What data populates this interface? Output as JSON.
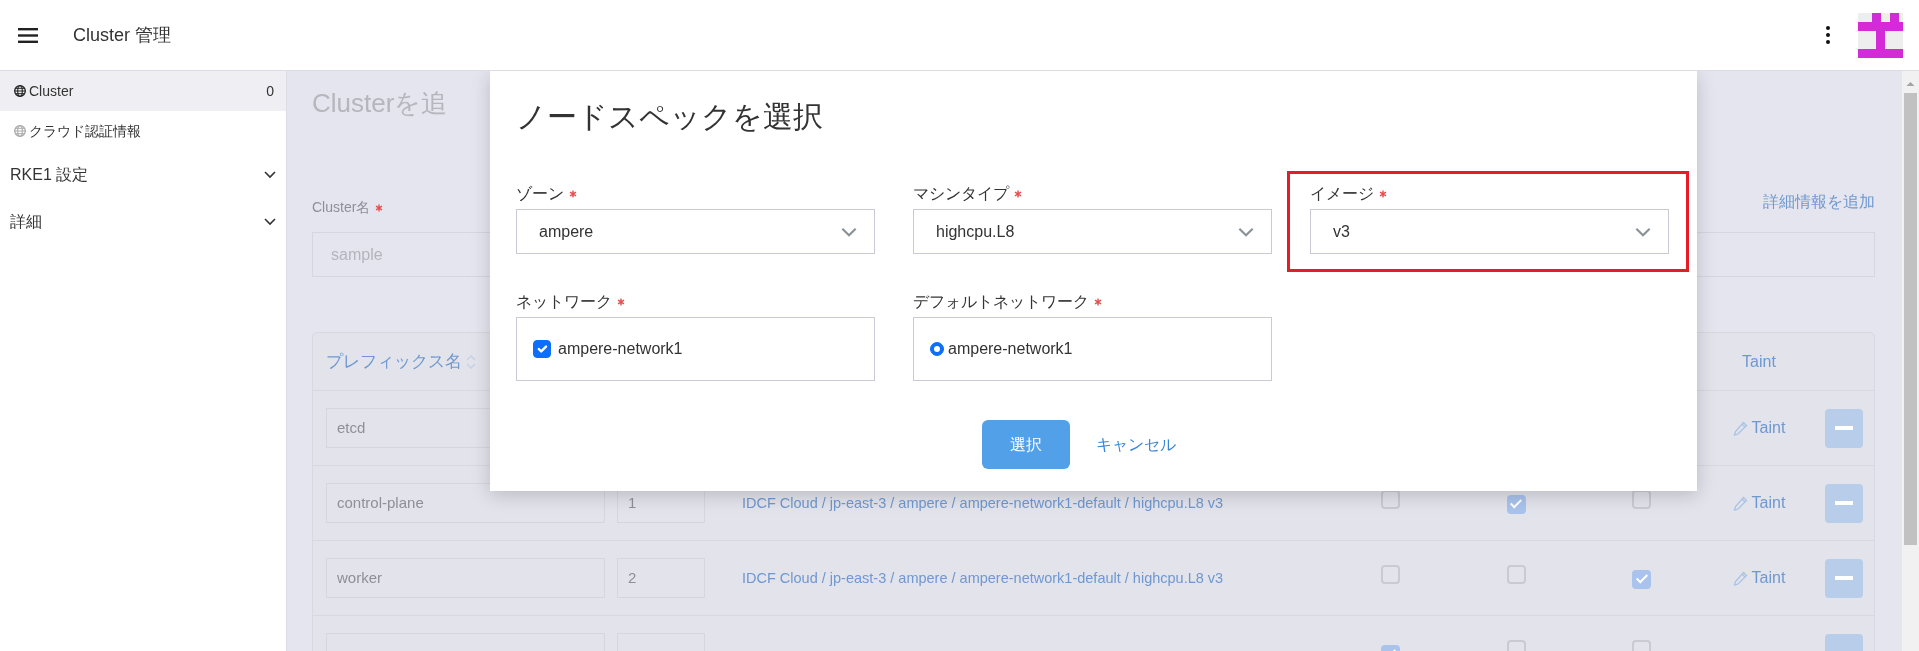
{
  "header": {
    "title": "Cluster 管理"
  },
  "sidebar": {
    "links": [
      {
        "label": "Cluster",
        "count": "0",
        "selected": true
      },
      {
        "label": "クラウド認証情報",
        "selected": false
      }
    ],
    "groups": [
      {
        "label": "RKE1 設定",
        "expanded": false
      },
      {
        "label": "詳細",
        "expanded": false
      }
    ]
  },
  "page": {
    "title": "Clusterを追",
    "name_label": "Cluster名",
    "name_required": true,
    "name_value": "sample",
    "detail_link": "詳細情報を追加"
  },
  "table": {
    "prefix_header": "プレフィックス名",
    "taint_header": "Taint",
    "rows": [
      {
        "prefix": "etcd",
        "taint": "Taint"
      },
      {
        "prefix": "control-plane",
        "count": "1",
        "spec": "IDCF Cloud / jp-east-3 / ampere / ampere-network1-default / highcpu.L8 v3",
        "flags": [
          {
            "checked": false
          },
          {
            "checked": true
          },
          {
            "checked": false
          }
        ],
        "taint": "Taint"
      },
      {
        "prefix": "worker",
        "count": "2",
        "spec": "IDCF Cloud / jp-east-3 / ampere / ampere-network1-default / highcpu.L8 v3",
        "flags": [
          {
            "checked": false
          },
          {
            "checked": false
          },
          {
            "checked": true
          }
        ],
        "taint": "Taint"
      },
      {
        "flags": [
          {
            "checked": true
          },
          {
            "checked": false
          },
          {
            "checked": false
          }
        ]
      }
    ]
  },
  "modal": {
    "title": "ノードスペックを選択",
    "fields": [
      {
        "kind": "select",
        "label": "ゾーン",
        "required": true,
        "value": "ampere",
        "highlighted": false
      },
      {
        "kind": "select",
        "label": "マシンタイプ",
        "required": true,
        "value": "highcpu.L8",
        "highlighted": false
      },
      {
        "kind": "select",
        "label": "イメージ",
        "required": true,
        "value": "v3",
        "highlighted": true
      },
      {
        "kind": "checkbox",
        "label": "ネットワーク",
        "required": true,
        "options": [
          {
            "label": "ampere-network1",
            "checked": true
          }
        ]
      },
      {
        "kind": "radio",
        "label": "デフォルトネットワーク",
        "required": true,
        "options": [
          {
            "label": "ampere-network1",
            "selected": true
          }
        ]
      }
    ],
    "buttons": [
      {
        "kind": "primary",
        "label": "選択"
      },
      {
        "kind": "link",
        "label": "キャンセル"
      }
    ]
  }
}
